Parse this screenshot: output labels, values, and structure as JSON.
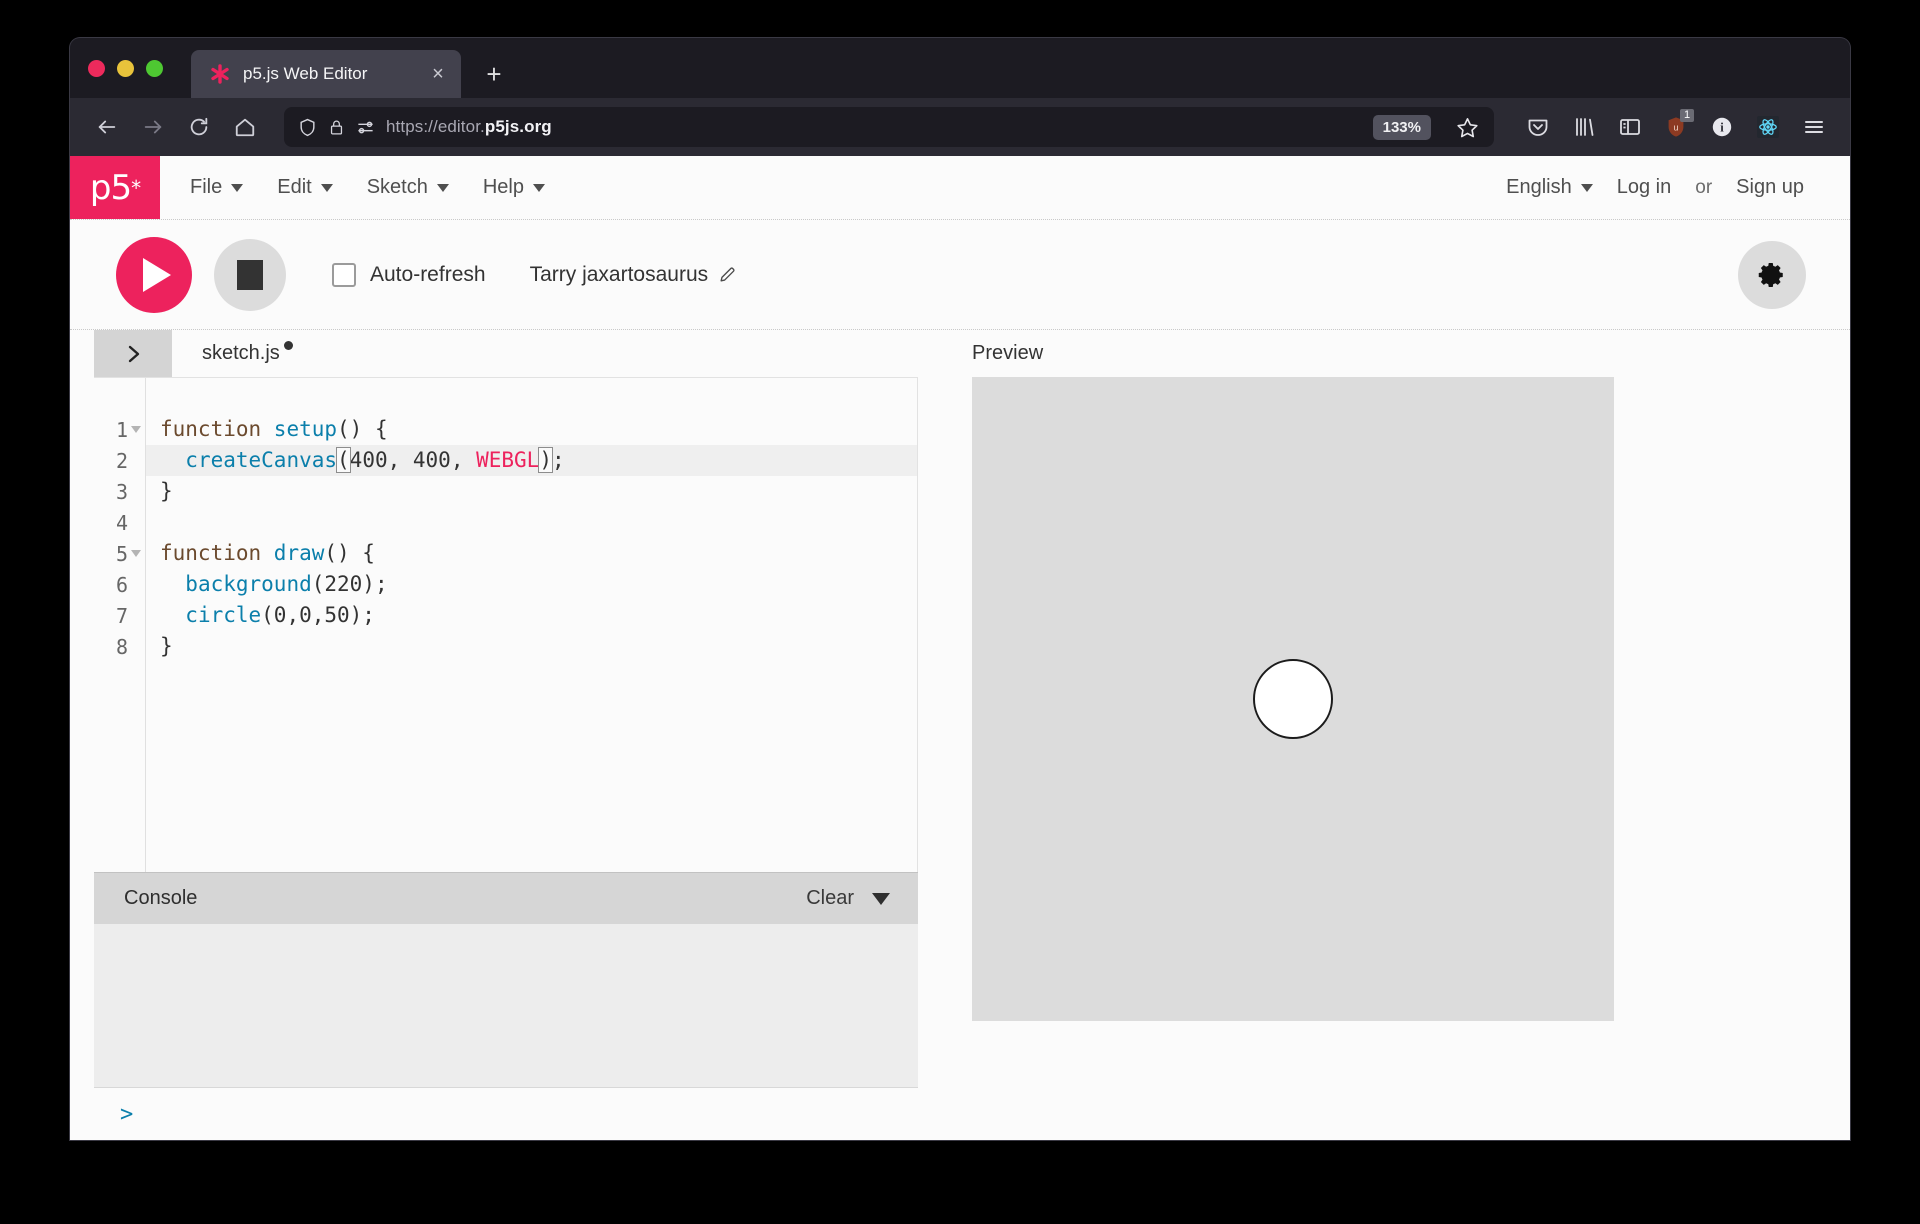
{
  "browser": {
    "tab": {
      "title": "p5.js Web Editor",
      "favicon": "p5-asterisk-icon"
    },
    "new_tab_label": "+",
    "close_label": "×",
    "nav": {
      "back_icon": "back-arrow-icon",
      "forward_icon": "forward-arrow-icon",
      "reload_icon": "reload-icon",
      "home_icon": "home-icon"
    },
    "url": {
      "scheme": "https://editor.",
      "domain": "p5js.org"
    },
    "zoom_level": "133%",
    "toolbar_icons": [
      "pocket-icon",
      "library-icon",
      "sidebar-icon",
      "ublock-origin-icon",
      "info-icon",
      "react-devtools-icon",
      "menu-icon"
    ],
    "ublock_badge": "1"
  },
  "p5nav": {
    "logo": "p5",
    "logo_star": "*",
    "menu": [
      {
        "label": "File"
      },
      {
        "label": "Edit"
      },
      {
        "label": "Sketch"
      },
      {
        "label": "Help"
      }
    ],
    "language": "English",
    "login": "Log in",
    "or": "or",
    "signup": "Sign up"
  },
  "toolbar": {
    "play_icon": "play-icon",
    "stop_icon": "stop-icon",
    "autorefresh_label": "Auto-refresh",
    "autorefresh_checked": false,
    "sketch_name": "Tarry jaxartosaurus",
    "edit_icon": "pencil-icon",
    "settings_icon": "gear-icon"
  },
  "editor": {
    "sidebar_toggle_icon": "chevron-right-icon",
    "filename": "sketch.js",
    "unsaved": true,
    "lines": [
      {
        "n": "1",
        "fold": true,
        "tokens": [
          {
            "t": "function ",
            "c": "tok-kw"
          },
          {
            "t": "setup",
            "c": "tok-fn"
          },
          {
            "t": "() {",
            "c": "tok-punc"
          }
        ]
      },
      {
        "n": "2",
        "fold": false,
        "active": true,
        "tokens": [
          {
            "t": "  ",
            "c": "tok-punc"
          },
          {
            "t": "createCanvas",
            "c": "tok-fn"
          },
          {
            "t": "(",
            "c": "tok-punc bracket-match"
          },
          {
            "t": "400, 400, ",
            "c": "tok-num"
          },
          {
            "t": "WEBGL",
            "c": "tok-const"
          },
          {
            "t": ")",
            "c": "tok-punc bracket-match"
          },
          {
            "t": ";",
            "c": "tok-punc"
          }
        ]
      },
      {
        "n": "3",
        "fold": false,
        "tokens": [
          {
            "t": "}",
            "c": "tok-punc"
          }
        ]
      },
      {
        "n": "4",
        "fold": false,
        "tokens": [
          {
            "t": "",
            "c": "tok-punc"
          }
        ]
      },
      {
        "n": "5",
        "fold": true,
        "tokens": [
          {
            "t": "function ",
            "c": "tok-kw"
          },
          {
            "t": "draw",
            "c": "tok-fn"
          },
          {
            "t": "() {",
            "c": "tok-punc"
          }
        ]
      },
      {
        "n": "6",
        "fold": false,
        "tokens": [
          {
            "t": "  ",
            "c": "tok-punc"
          },
          {
            "t": "background",
            "c": "tok-fn"
          },
          {
            "t": "(220);",
            "c": "tok-punc"
          }
        ]
      },
      {
        "n": "7",
        "fold": false,
        "tokens": [
          {
            "t": "  ",
            "c": "tok-punc"
          },
          {
            "t": "circle",
            "c": "tok-fn"
          },
          {
            "t": "(0,0,50);",
            "c": "tok-punc"
          }
        ]
      },
      {
        "n": "8",
        "fold": false,
        "tokens": [
          {
            "t": "}",
            "c": "tok-punc"
          }
        ]
      }
    ]
  },
  "console": {
    "title": "Console",
    "clear_label": "Clear",
    "collapse_icon": "chevron-down-icon",
    "prompt": ">",
    "output": ""
  },
  "preview": {
    "title": "Preview",
    "canvas_bg": "#dcdcdc",
    "shape": "circle",
    "shape_fill": "#ffffff",
    "shape_stroke": "#1c1c1c"
  },
  "colors": {
    "brand_pink": "#ed225d",
    "browser_chrome": "#2b2a33",
    "browser_tabstrip": "#1c1b22",
    "page_bg": "#fbfbfb"
  }
}
